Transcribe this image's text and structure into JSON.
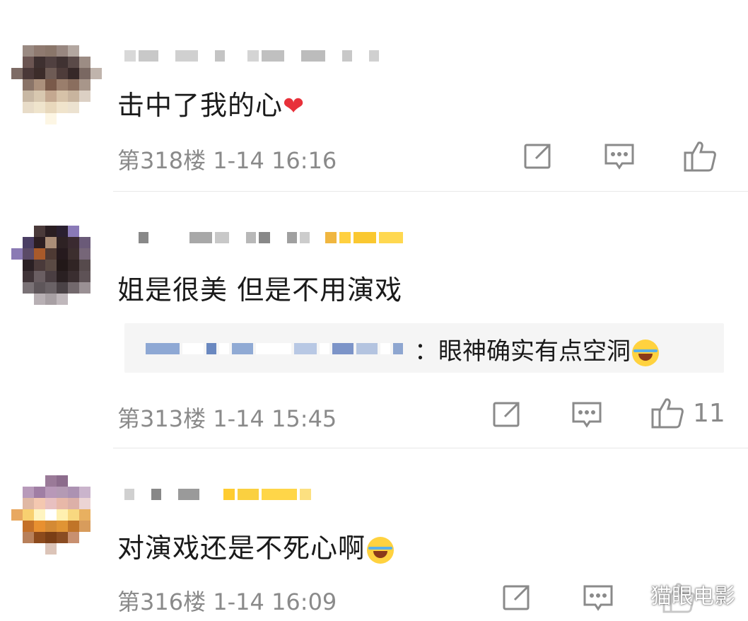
{
  "comments": [
    {
      "text": "击中了我的心",
      "emoji": "red-heart",
      "floor": "第318楼",
      "time": "1-14 16:16",
      "likes": ""
    },
    {
      "text": "姐是很美 但是不用演戏",
      "reply": {
        "text": "：眼神确实有点空洞",
        "emoji": "tears-of-joy"
      },
      "floor": "第313楼",
      "time": "1-14 15:45",
      "likes": "11"
    },
    {
      "text": "对演戏还是不死心啊",
      "emoji": "tears-of-joy",
      "floor": "第316楼",
      "time": "1-14 16:09",
      "likes": ""
    }
  ],
  "watermark": "猫眼电影",
  "icons": [
    "share-icon",
    "comment-icon",
    "like-icon"
  ],
  "colors": {
    "text": "#1a1a1a",
    "meta": "#8a8a8a",
    "heart": "#e8313a",
    "reply_bg": "#f5f5f5"
  }
}
